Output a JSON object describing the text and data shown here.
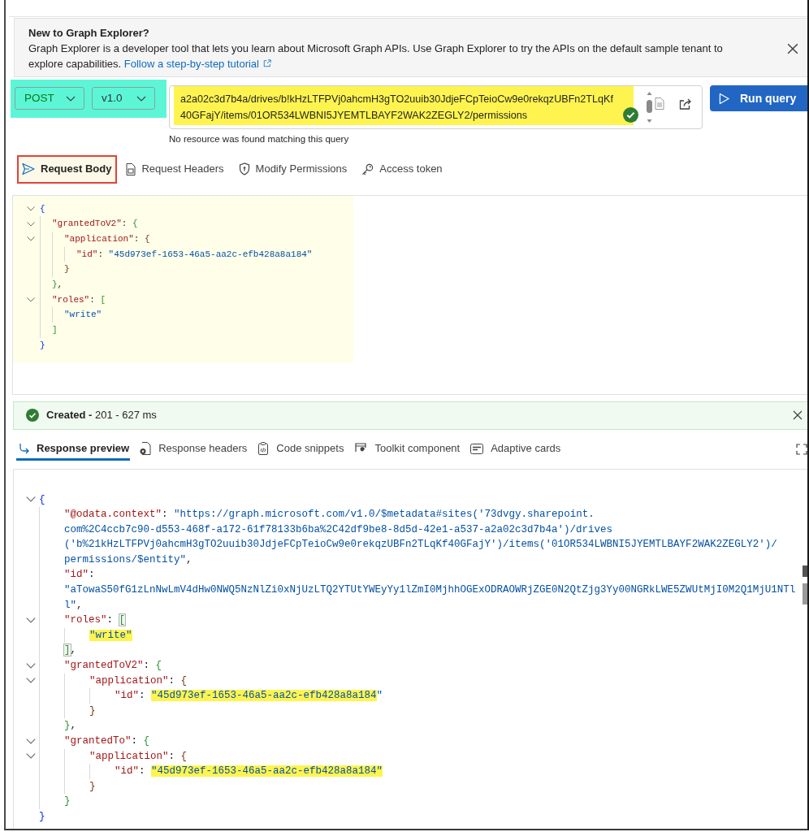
{
  "banner": {
    "title": "New to Graph Explorer?",
    "text": "Graph Explorer is a developer tool that lets you learn about Microsoft Graph APIs. Use Graph Explorer to try the APIs on the default sample tenant to explore capabilities.",
    "link": "Follow a step-by-step tutorial"
  },
  "query": {
    "method": "POST",
    "version": "v1.0",
    "selectors_highlighted": true,
    "url_lines": [
      "a2a02c3d7b4a/drives/b!kHzLTFPVj0ahcmH3gTO2uuib30JdjeFCpTeioCw9e0rekqzUBFn2TLqKf",
      "40GFajY/items/01OR534LWBNI5JYEMTLBAYF2WAK2ZEGLY2/permissions"
    ],
    "url_highlighted": true,
    "validated": true,
    "message": "No resource was found matching this query",
    "run_label": "Run query"
  },
  "request_tabs": [
    {
      "label": "Request Body",
      "selected": true,
      "highlighted": true
    },
    {
      "label": "Request Headers",
      "selected": false,
      "highlighted": false
    },
    {
      "label": "Modify Permissions",
      "selected": false,
      "highlighted": false
    },
    {
      "label": "Access token",
      "selected": false,
      "highlighted": false
    }
  ],
  "request_body": {
    "lines": [
      {
        "fold": true,
        "tokens": [
          {
            "kind": "bracket",
            "text": "{",
            "highlighted": false,
            "matched": false
          }
        ],
        "children": [
          {
            "fold": true,
            "tokens": [
              {
                "kind": "key",
                "text": "\"grantedToV2\"",
                "highlighted": false,
                "matched": false
              },
              {
                "kind": "punct",
                "text": ": ",
                "highlighted": false,
                "matched": false
              },
              {
                "kind": "bracket",
                "text": "{",
                "highlighted": false,
                "matched": false
              }
            ],
            "children": [
              {
                "fold": true,
                "tokens": [
                  {
                    "kind": "key",
                    "text": "\"application\"",
                    "highlighted": false,
                    "matched": false
                  },
                  {
                    "kind": "punct",
                    "text": ": ",
                    "highlighted": false,
                    "matched": false
                  },
                  {
                    "kind": "bracket",
                    "text": "{",
                    "highlighted": false,
                    "matched": false
                  }
                ],
                "children": [
                  {
                    "fold": false,
                    "tokens": [
                      {
                        "kind": "key",
                        "text": "\"id\"",
                        "highlighted": false,
                        "matched": false
                      },
                      {
                        "kind": "punct",
                        "text": ": ",
                        "highlighted": false,
                        "matched": false
                      },
                      {
                        "kind": "string",
                        "text": "\"45d973ef-1653-46a5-aa2c-efb428a8a184\"",
                        "highlighted": false,
                        "matched": false
                      }
                    ]
                  }
                ]
              },
              {
                "fold": false,
                "tokens": [
                  {
                    "kind": "bracket",
                    "text": "}",
                    "highlighted": false,
                    "matched": false
                  }
                ]
              }
            ]
          },
          {
            "fold": false,
            "tokens": [
              {
                "kind": "bracket",
                "text": "}",
                "highlighted": false,
                "matched": false
              },
              {
                "kind": "punct",
                "text": ",",
                "highlighted": false,
                "matched": false
              }
            ]
          },
          {
            "fold": true,
            "tokens": [
              {
                "kind": "key",
                "text": "\"roles\"",
                "highlighted": false,
                "matched": false
              },
              {
                "kind": "punct",
                "text": ": ",
                "highlighted": false,
                "matched": false
              },
              {
                "kind": "bracket",
                "text": "[",
                "highlighted": false,
                "matched": false
              }
            ],
            "children": [
              {
                "fold": false,
                "tokens": [
                  {
                    "kind": "string",
                    "text": "\"write\"",
                    "highlighted": false,
                    "matched": false
                  }
                ]
              }
            ]
          },
          {
            "fold": false,
            "tokens": [
              {
                "kind": "bracket",
                "text": "]",
                "highlighted": false,
                "matched": false
              }
            ]
          }
        ]
      },
      {
        "fold": false,
        "tokens": [
          {
            "kind": "bracket",
            "text": "}",
            "highlighted": false,
            "matched": false
          }
        ]
      }
    ]
  },
  "status": {
    "kind": "success",
    "message": "**Created -** 201 - 627 ms"
  },
  "response_tabs": [
    {
      "label": "Response preview",
      "selected": true
    },
    {
      "label": "Response headers",
      "selected": false
    },
    {
      "label": "Code snippets",
      "selected": false
    },
    {
      "label": "Toolkit component",
      "selected": false
    },
    {
      "label": "Adaptive cards",
      "selected": false
    }
  ],
  "response_body": {
    "lines": [
      {
        "fold": true,
        "tokens": [
          {
            "kind": "bracket",
            "text": "{",
            "highlighted": false,
            "matched": false
          }
        ],
        "children": [
          {
            "fold": false,
            "tokens": [
              {
                "kind": "key",
                "text": "\"@odata.context\"",
                "highlighted": false,
                "matched": false
              },
              {
                "kind": "punct",
                "text": ": ",
                "highlighted": false,
                "matched": false
              },
              {
                "kind": "string",
                "text": "\"https://graph.microsoft.com/v1.0/$metadata#sites('73dvgy.sharepoint.",
                "highlighted": false,
                "matched": false
              }
            ]
          },
          {
            "fold": false,
            "tokens": [
              {
                "kind": "string",
                "text": "com%2C4ccb7c90-d553-468f-a172-61f78133b6ba%2C42df9be8-8d5d-42e1-a537-a2a02c3d7b4a')/drives",
                "highlighted": false,
                "matched": false
              }
            ]
          },
          {
            "fold": false,
            "tokens": [
              {
                "kind": "string",
                "text": "('b%21kHzLTFPVj0ahcmH3gTO2uuib30JdjeFCpTeioCw9e0rekqzUBFn2TLqKf40GFajY')/items('01OR534LWBNI5JYEMTLBAYF2WAK2ZEGLY2')/",
                "highlighted": false,
                "matched": false
              }
            ]
          },
          {
            "fold": false,
            "tokens": [
              {
                "kind": "string",
                "text": "permissions/$entity\"",
                "highlighted": false,
                "matched": false
              },
              {
                "kind": "punct",
                "text": ",",
                "highlighted": false,
                "matched": false
              }
            ]
          },
          {
            "fold": false,
            "tokens": [
              {
                "kind": "key",
                "text": "\"id\"",
                "highlighted": false,
                "matched": false
              },
              {
                "kind": "punct",
                "text": ":",
                "highlighted": false,
                "matched": false
              }
            ]
          },
          {
            "fold": false,
            "tokens": [
              {
                "kind": "string",
                "text": "\"aTowaS50fG1zLnNwLmV4dHw0NWQ5NzNlZi0xNjUzLTQ2YTUtYWEyYy1lZmI0MjhhOGExODRAOWRjZGE0N2QtZjg3Yy00NGRkLWE5ZWUtMjI0M2Q1MjU1NTl",
                "highlighted": false,
                "matched": false
              }
            ]
          },
          {
            "fold": false,
            "tokens": [
              {
                "kind": "string",
                "text": "l\"",
                "highlighted": false,
                "matched": false
              },
              {
                "kind": "punct",
                "text": ",",
                "highlighted": false,
                "matched": false
              }
            ]
          },
          {
            "fold": true,
            "tokens": [
              {
                "kind": "key",
                "text": "\"roles\"",
                "highlighted": false,
                "matched": false
              },
              {
                "kind": "punct",
                "text": ": ",
                "highlighted": false,
                "matched": false
              },
              {
                "kind": "bracket",
                "text": "[",
                "highlighted": false,
                "matched": true
              }
            ],
            "children": [
              {
                "fold": false,
                "tokens": [
                  {
                    "kind": "string",
                    "text": "\"write\"",
                    "highlighted": true,
                    "matched": false
                  }
                ]
              }
            ]
          },
          {
            "fold": false,
            "tokens": [
              {
                "kind": "bracket",
                "text": "]",
                "highlighted": false,
                "matched": true
              },
              {
                "kind": "punct",
                "text": ",",
                "highlighted": false,
                "matched": false
              }
            ]
          },
          {
            "fold": true,
            "tokens": [
              {
                "kind": "key",
                "text": "\"grantedToV2\"",
                "highlighted": false,
                "matched": false
              },
              {
                "kind": "punct",
                "text": ": ",
                "highlighted": false,
                "matched": false
              },
              {
                "kind": "bracket",
                "text": "{",
                "highlighted": false,
                "matched": false
              }
            ],
            "children": [
              {
                "fold": true,
                "tokens": [
                  {
                    "kind": "key",
                    "text": "\"application\"",
                    "highlighted": false,
                    "matched": false
                  },
                  {
                    "kind": "punct",
                    "text": ": ",
                    "highlighted": false,
                    "matched": false
                  },
                  {
                    "kind": "bracket",
                    "text": "{",
                    "highlighted": false,
                    "matched": false
                  }
                ],
                "children": [
                  {
                    "fold": false,
                    "tokens": [
                      {
                        "kind": "key",
                        "text": "\"id\"",
                        "highlighted": false,
                        "matched": false
                      },
                      {
                        "kind": "punct",
                        "text": ": ",
                        "highlighted": false,
                        "matched": false
                      },
                      {
                        "kind": "string",
                        "text": "\"45d973ef-1653-46a5-aa2c-efb428a8a184",
                        "highlighted": true,
                        "matched": false
                      },
                      {
                        "kind": "string",
                        "text": "\"",
                        "highlighted": false,
                        "matched": false
                      }
                    ]
                  }
                ]
              },
              {
                "fold": false,
                "tokens": [
                  {
                    "kind": "bracket",
                    "text": "}",
                    "highlighted": false,
                    "matched": false
                  }
                ]
              }
            ]
          },
          {
            "fold": false,
            "tokens": [
              {
                "kind": "bracket",
                "text": "}",
                "highlighted": false,
                "matched": false
              },
              {
                "kind": "punct",
                "text": ",",
                "highlighted": false,
                "matched": false
              }
            ]
          },
          {
            "fold": true,
            "tokens": [
              {
                "kind": "key",
                "text": "\"grantedTo\"",
                "highlighted": false,
                "matched": false
              },
              {
                "kind": "punct",
                "text": ": ",
                "highlighted": false,
                "matched": false
              },
              {
                "kind": "bracket",
                "text": "{",
                "highlighted": false,
                "matched": false
              }
            ],
            "children": [
              {
                "fold": true,
                "tokens": [
                  {
                    "kind": "key",
                    "text": "\"application\"",
                    "highlighted": false,
                    "matched": false
                  },
                  {
                    "kind": "punct",
                    "text": ": ",
                    "highlighted": false,
                    "matched": false
                  },
                  {
                    "kind": "bracket",
                    "text": "{",
                    "highlighted": false,
                    "matched": false
                  }
                ],
                "children": [
                  {
                    "fold": false,
                    "tokens": [
                      {
                        "kind": "key",
                        "text": "\"id\"",
                        "highlighted": false,
                        "matched": false
                      },
                      {
                        "kind": "punct",
                        "text": ": ",
                        "highlighted": false,
                        "matched": false
                      },
                      {
                        "kind": "string",
                        "text": "\"45d973ef-1653-46a5-aa2c-efb428a8a184\"",
                        "highlighted": true,
                        "matched": false
                      }
                    ]
                  }
                ]
              },
              {
                "fold": false,
                "tokens": [
                  {
                    "kind": "bracket",
                    "text": "}",
                    "highlighted": false,
                    "matched": false
                  }
                ]
              }
            ]
          },
          {
            "fold": false,
            "tokens": [
              {
                "kind": "bracket",
                "text": "}",
                "highlighted": false,
                "matched": false
              }
            ]
          }
        ]
      },
      {
        "fold": false,
        "tokens": [
          {
            "kind": "bracket",
            "text": "}",
            "highlighted": false,
            "matched": false
          }
        ]
      }
    ]
  }
}
